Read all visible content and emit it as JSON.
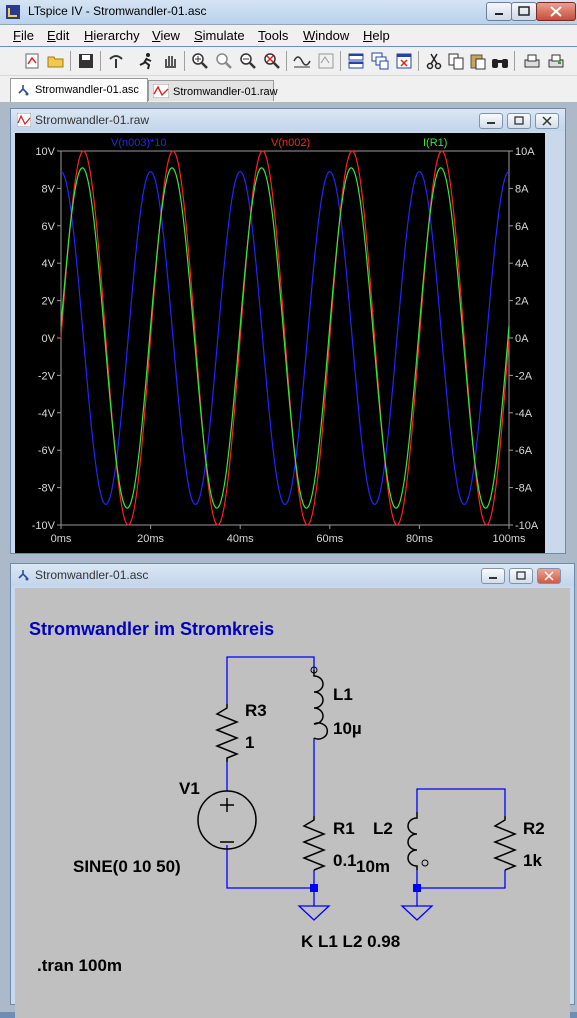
{
  "window": {
    "title": "LTspice IV - Stromwandler-01.asc"
  },
  "menu": [
    {
      "label": "File",
      "u": "F",
      "rest": "ile"
    },
    {
      "label": "Edit",
      "u": "E",
      "rest": "dit"
    },
    {
      "label": "Hierarchy",
      "u": "H",
      "rest": "ierarchy"
    },
    {
      "label": "View",
      "u": "V",
      "rest": "iew"
    },
    {
      "label": "Simulate",
      "u": "S",
      "rest": "imulate"
    },
    {
      "label": "Tools",
      "u": "T",
      "rest": "ools"
    },
    {
      "label": "Window",
      "u": "W",
      "rest": "indow"
    },
    {
      "label": "Help",
      "u": "H",
      "rest": "elp"
    }
  ],
  "toolbar": [
    "open-schematic-icon",
    "open-file-icon",
    "save-icon",
    "control-panel-icon",
    "run-icon",
    "pan-hand-icon",
    "zoom-in-icon",
    "zoom-area-icon",
    "zoom-out-icon",
    "zoom-fit-icon",
    "autorange-icon",
    "plot-settings-icon",
    "tile-horizontal-icon",
    "cascade-icon",
    "close-windows-icon",
    "cut-icon",
    "copy-icon",
    "paste-icon",
    "find-icon",
    "print-setup-icon",
    "print-icon"
  ],
  "tabs": [
    {
      "label": "Stromwandler-01.asc",
      "active": true
    },
    {
      "label": "Stromwandler-01.raw",
      "active": false
    }
  ],
  "waveform_window": {
    "title": "Stromwandler-01.raw"
  },
  "schematic_window": {
    "title": "Stromwandler-01.asc"
  },
  "chart_data": {
    "type": "line",
    "title": "",
    "xlabel": "",
    "ylabel": "",
    "xlim": [
      0,
      100
    ],
    "x_ticks": [
      "0ms",
      "20ms",
      "40ms",
      "60ms",
      "80ms",
      "100ms"
    ],
    "ylim_left": [
      -10,
      10
    ],
    "y_ticks_left": [
      "10V",
      "8V",
      "6V",
      "4V",
      "2V",
      "0V",
      "-2V",
      "-4V",
      "-6V",
      "-8V",
      "-10V"
    ],
    "ylim_right": [
      -10,
      10
    ],
    "y_ticks_right": [
      "10A",
      "8A",
      "6A",
      "4A",
      "2A",
      "0A",
      "-2A",
      "-4A",
      "-6A",
      "-8A",
      "-10A"
    ],
    "grid": false,
    "background": "#000000",
    "frequency_hz": 50,
    "series": [
      {
        "name": "V(n003)*10",
        "color": "#2424ff",
        "amplitude": 8.9,
        "phase_deg": 90,
        "axis": "left"
      },
      {
        "name": "V(n002)",
        "color": "#ff2020",
        "amplitude": 10.0,
        "phase_deg": 0,
        "axis": "left"
      },
      {
        "name": "I(R1)",
        "color": "#39e639",
        "amplitude": 9.1,
        "phase_deg": 4,
        "axis": "right"
      }
    ]
  },
  "schematic": {
    "heading": "Stromwandler im Stromkreis",
    "heading_color": "#0000c0",
    "wire_color": "#0000ff",
    "components": {
      "R3": {
        "name": "R3",
        "value": "1"
      },
      "L1": {
        "name": "L1",
        "value": "10µ"
      },
      "V1": {
        "name": "V1",
        "value": "SINE(0 10 50)"
      },
      "R1": {
        "name": "R1",
        "value": "0.1"
      },
      "L2": {
        "name": "L2",
        "value": "10m"
      },
      "R2": {
        "name": "R2",
        "value": "1k"
      }
    },
    "coupling": "K L1 L2 0.98",
    "directive": ".tran 100m"
  }
}
